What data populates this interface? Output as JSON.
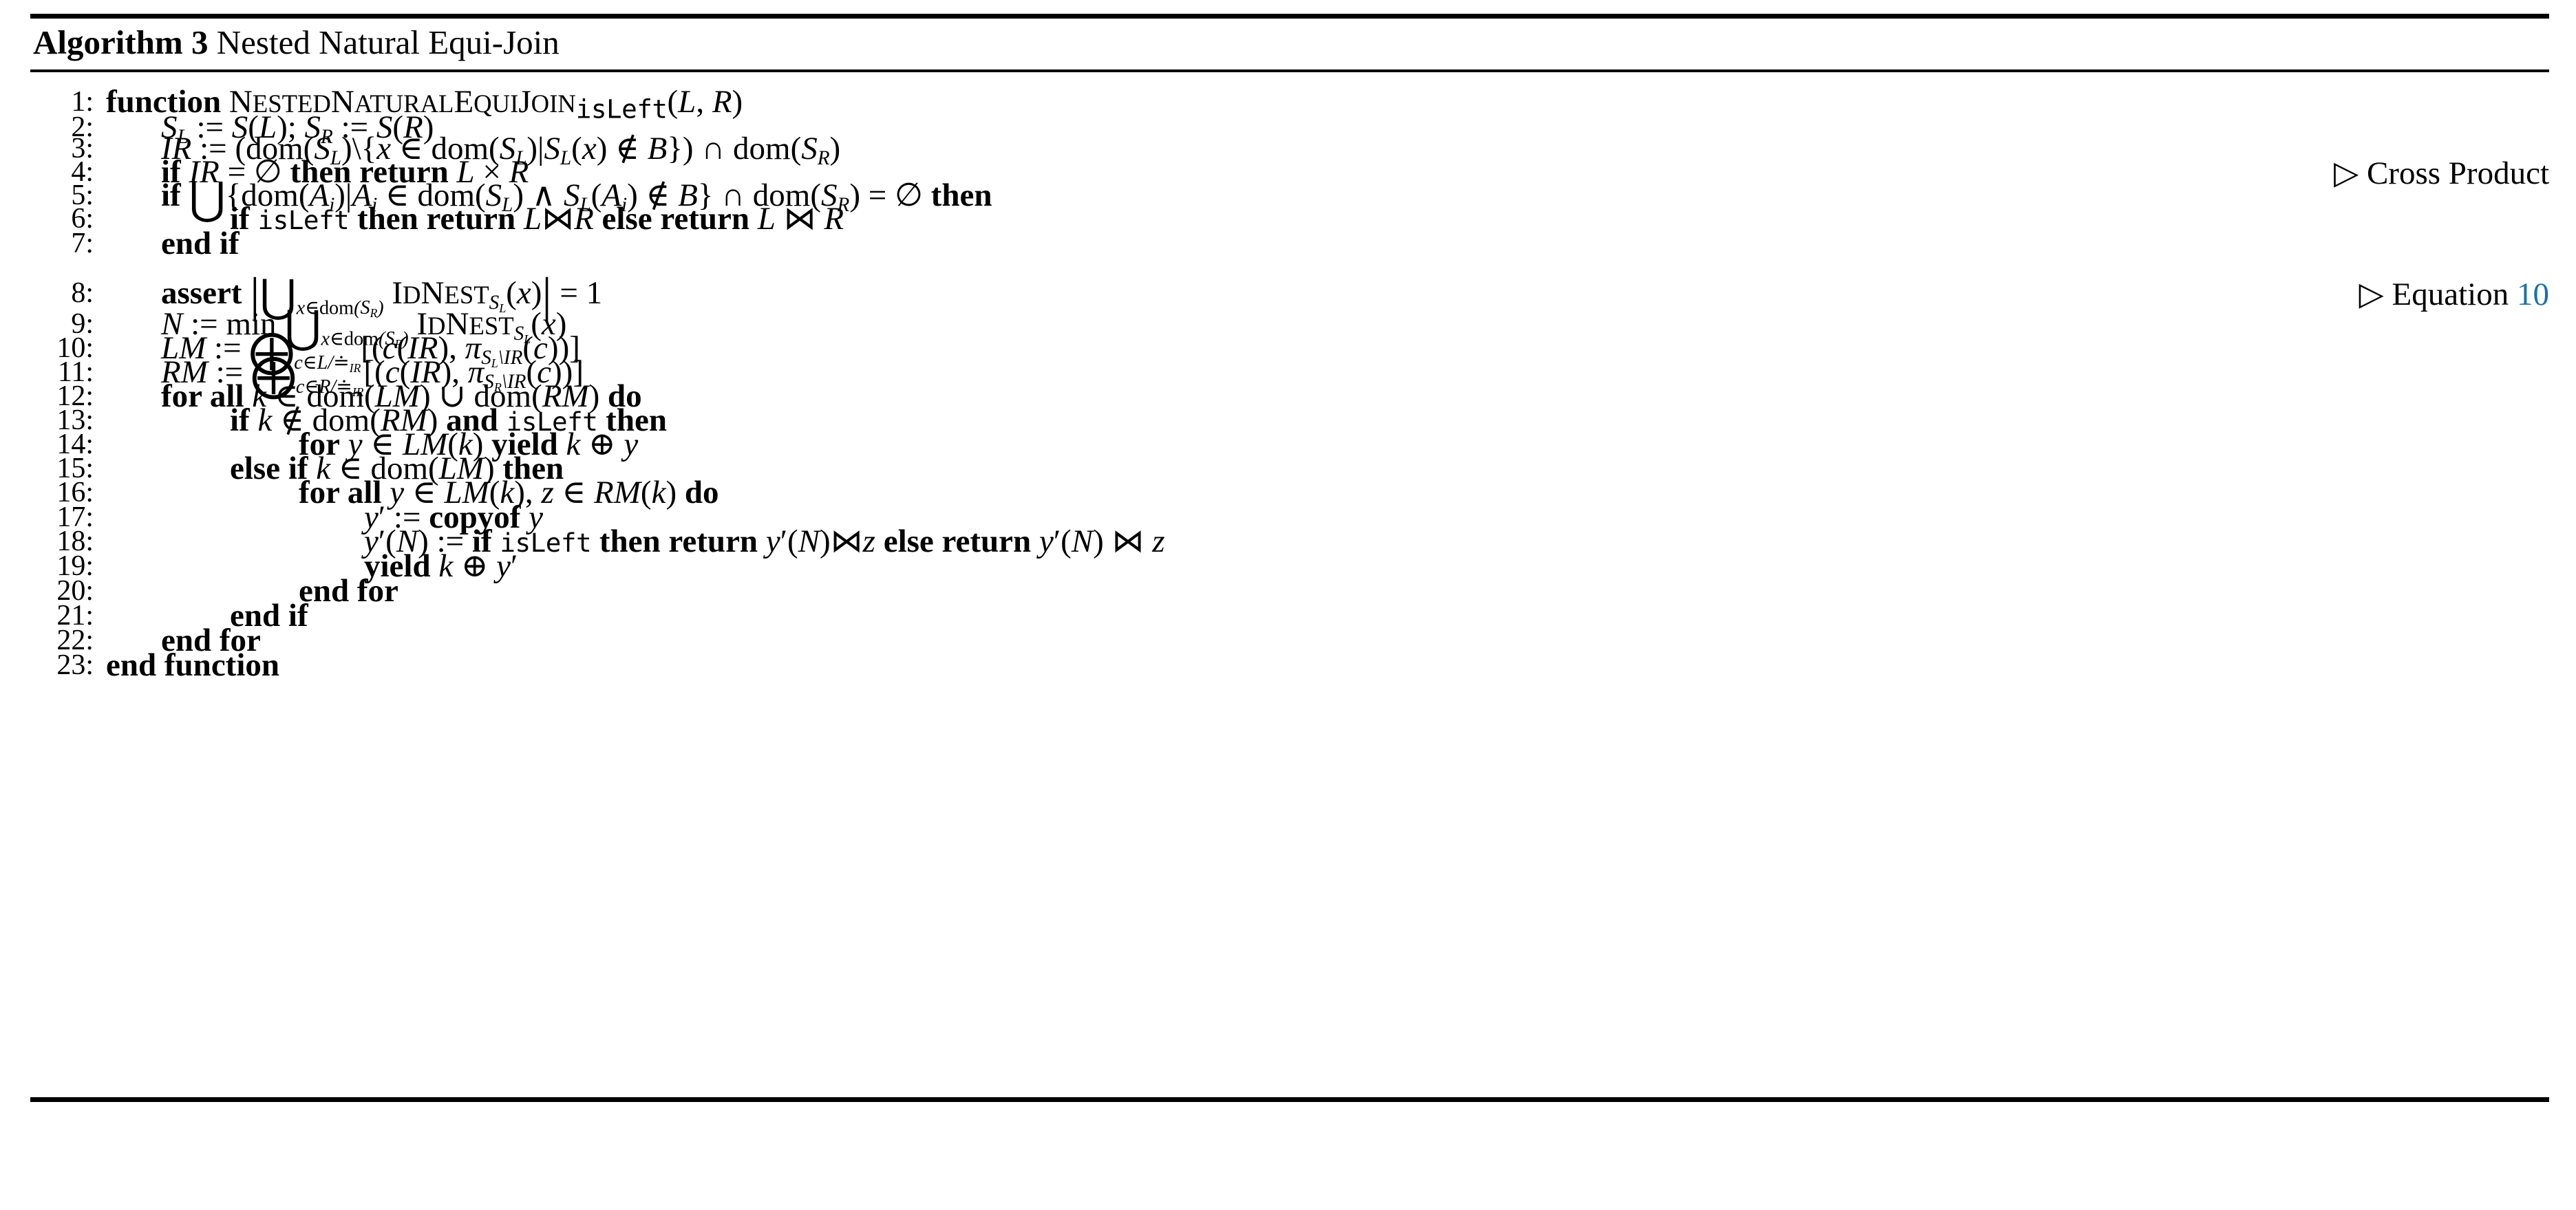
{
  "caption": {
    "label": "Algorithm 3",
    "title": "Nested Natural Equi-Join"
  },
  "colors": {
    "text": "#000000",
    "rule": "#000000",
    "link": "#1a6fb0",
    "background": "#ffffff"
  },
  "lines": [
    {
      "no": "1:",
      "indent": 0,
      "text": "function NESTEDNATURALEQUIJOIN_isLeft(L, R)",
      "comment": ""
    },
    {
      "no": "2:",
      "indent": 1,
      "text": "S_L := S(L); S_R := S(R)",
      "comment": ""
    },
    {
      "no": "3:",
      "indent": 1,
      "text": "IR := (dom(S_L)\\{x ∈ dom(S_L)|S_L(x) ∉ B}) ∩ dom(S_R)",
      "comment": ""
    },
    {
      "no": "4:",
      "indent": 1,
      "text": "if IR = ∅ then return L × R",
      "comment": "▷ Cross Product"
    },
    {
      "no": "5:",
      "indent": 1,
      "text": "if ⋃{dom(A_i)|A_i ∈ dom(S_L) ∧ S_L(A_i) ∉ B} ∩ dom(S_R) = ∅ then",
      "comment": ""
    },
    {
      "no": "6:",
      "indent": 2,
      "text": "if isLeft then return L⋈R else return L ⋈ R",
      "comment": ""
    },
    {
      "no": "7:",
      "indent": 1,
      "text": "end if",
      "comment": ""
    },
    {
      "no": "8:",
      "indent": 1,
      "text": "assert |⋃_{x∈dom(S_R)} IDNEST_{S_L}(x)| = 1",
      "comment": "▷ Equation 10"
    },
    {
      "no": "9:",
      "indent": 1,
      "text": "N := min ⋃_{x∈dom(S_R)} IDNEST_{S_L}(x)",
      "comment": ""
    },
    {
      "no": "10:",
      "indent": 1,
      "text": "LM := ⨁_{c∈L/≐_IR} [(c(IR), π_{S_L\\IR}(c))]",
      "comment": ""
    },
    {
      "no": "11:",
      "indent": 1,
      "text": "RM := ⨁_{c∈R/≐_IR} [(c(IR), π_{S_R\\IR}(c))]",
      "comment": ""
    },
    {
      "no": "12:",
      "indent": 1,
      "text": "for all k ∈ dom(LM) ∪ dom(RM) do",
      "comment": ""
    },
    {
      "no": "13:",
      "indent": 2,
      "text": "if k ∉ dom(RM) and isLeft then",
      "comment": ""
    },
    {
      "no": "14:",
      "indent": 3,
      "text": "for y ∈ LM(k) yield k ⊕ y",
      "comment": ""
    },
    {
      "no": "15:",
      "indent": 2,
      "text": "else if k ∈ dom(LM) then",
      "comment": ""
    },
    {
      "no": "16:",
      "indent": 3,
      "text": "for all y ∈ LM(k), z ∈ RM(k) do",
      "comment": ""
    },
    {
      "no": "17:",
      "indent": 4,
      "text": "y′ := copyof y",
      "comment": ""
    },
    {
      "no": "18:",
      "indent": 4,
      "text": "y′(N) := if isLeft then return y′(N)⋈z else return y′(N) ⋈ z",
      "comment": ""
    },
    {
      "no": "19:",
      "indent": 4,
      "text": "yield k ⊕ y′",
      "comment": ""
    },
    {
      "no": "20:",
      "indent": 3,
      "text": "end for",
      "comment": ""
    },
    {
      "no": "21:",
      "indent": 2,
      "text": "end if",
      "comment": ""
    },
    {
      "no": "22:",
      "indent": 1,
      "text": "end for",
      "comment": ""
    },
    {
      "no": "23:",
      "indent": 0,
      "text": "end function",
      "comment": ""
    }
  ],
  "comments": {
    "cross_product": "▷ Cross Product",
    "equation": "▷ Equation",
    "equation_ref": "10"
  }
}
